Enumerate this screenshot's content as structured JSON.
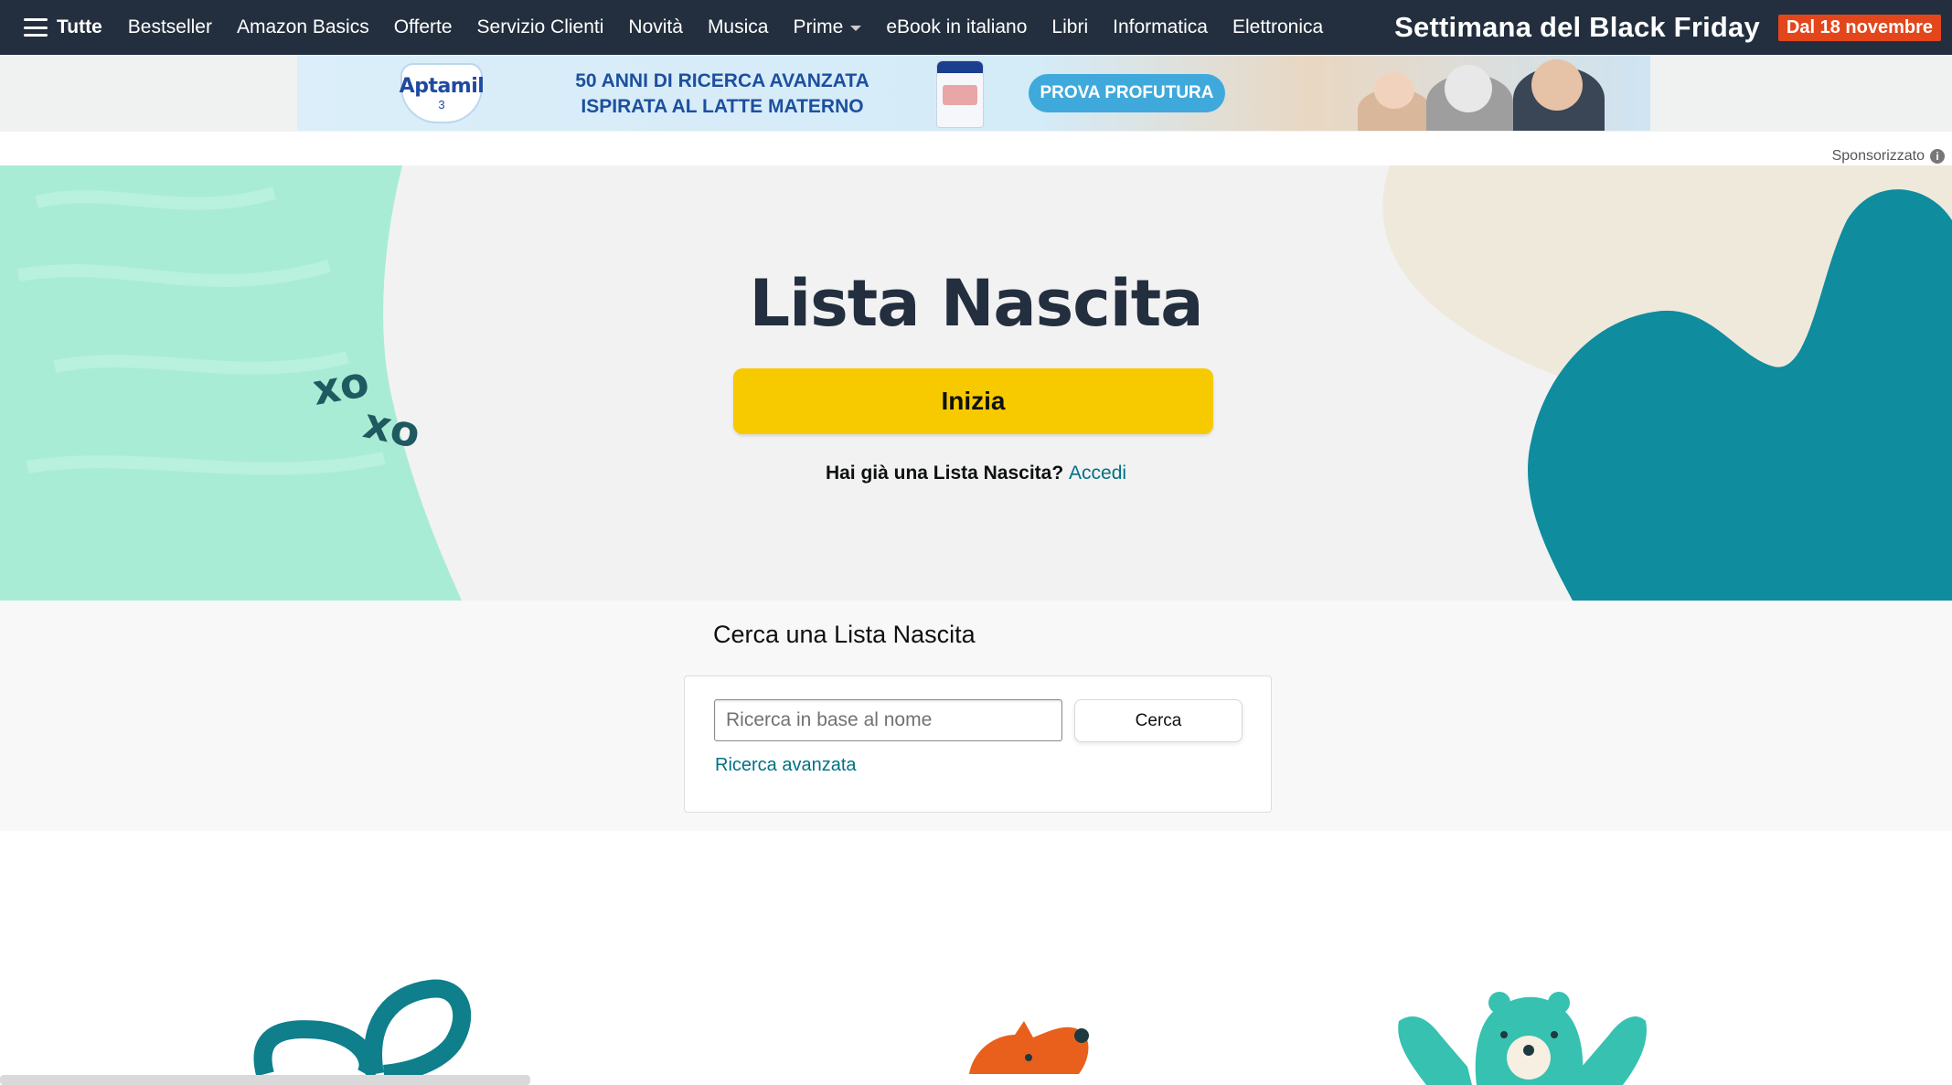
{
  "nav": {
    "all_label": "Tutte",
    "items": [
      {
        "label": "Bestseller"
      },
      {
        "label": "Amazon Basics"
      },
      {
        "label": "Offerte"
      },
      {
        "label": "Servizio Clienti"
      },
      {
        "label": "Novità"
      },
      {
        "label": "Musica"
      },
      {
        "label": "Prime"
      },
      {
        "label": "eBook in italiano"
      },
      {
        "label": "Libri"
      },
      {
        "label": "Informatica"
      },
      {
        "label": "Elettronica"
      }
    ],
    "promo": {
      "title": "Settimana del Black Friday",
      "badge": "Dal 18 novembre"
    }
  },
  "ad": {
    "brand": "Aptamil",
    "brand_sub": "3",
    "headline_1": "50 ANNI DI RICERCA AVANZATA",
    "headline_2": "ISPIRATA AL LATTE MATERNO",
    "cta": "PROVA PROFUTURA",
    "sponsored_label": "Sponsorizzato",
    "info_icon": "i"
  },
  "hero": {
    "title": "Lista Nascita",
    "start_button": "Inizia",
    "signin_prompt": "Hai già una Lista Nascita?",
    "signin_link": "Accedi",
    "decor_text_1": "xo",
    "decor_text_2": "xo"
  },
  "search": {
    "heading": "Cerca una Lista Nascita",
    "placeholder": "Ricerca in base al nome",
    "button": "Cerca",
    "advanced_link": "Ricerca avanzata"
  },
  "colors": {
    "nav_bg": "#232f3e",
    "accent_yellow": "#f7ca00",
    "link_teal": "#007185",
    "mint": "#a9ecd6",
    "teal_blob": "#0f8c9e",
    "badge_orange": "#e3461b"
  }
}
